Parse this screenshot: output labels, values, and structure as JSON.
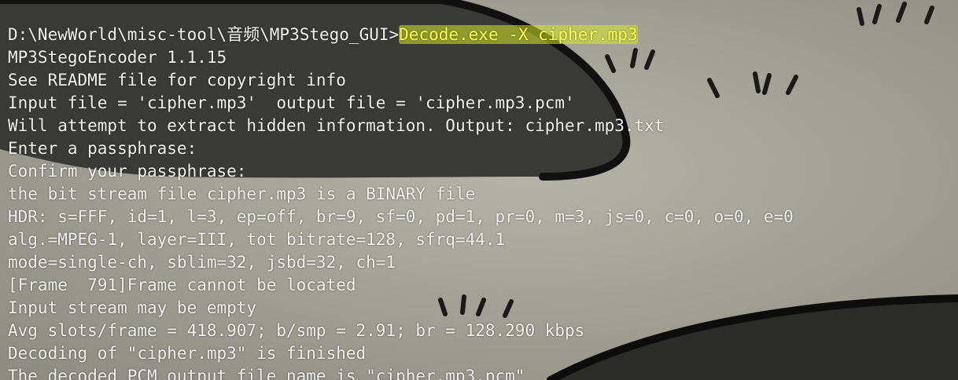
{
  "terminal": {
    "prompt": "D:\\NewWorld\\misc-tool\\音频\\MP3Stego_GUI>",
    "command": "Decode.exe -X cipher.mp3",
    "output": [
      "MP3StegoEncoder 1.1.15",
      "See README file for copyright info",
      "Input file = 'cipher.mp3'  output file = 'cipher.mp3.pcm'",
      "Will attempt to extract hidden information. Output: cipher.mp3.txt",
      "Enter a passphrase:",
      "Confirm your passphrase:",
      "the bit stream file cipher.mp3 is a BINARY file",
      "HDR: s=FFF, id=1, l=3, ep=off, br=9, sf=0, pd=1, pr=0, m=3, js=0, c=0, o=0, e=0",
      "alg.=MPEG-1, layer=III, tot bitrate=128, sfrq=44.1",
      "mode=single-ch, sblim=32, jsbd=32, ch=1",
      "[Frame  791]Frame cannot be located",
      "Input stream may be empty",
      "Avg slots/frame = 418.907; b/smp = 2.91; br = 128.290 kbps",
      "Decoding of \"cipher.mp3\" is finished",
      "The decoded PCM output file name is \"cipher.mp3.pcm\""
    ]
  },
  "colors": {
    "text": "#f0f0f0",
    "command_highlight": "#d7eb28",
    "command_text": "#ffff55",
    "background": "#9a9a90"
  }
}
